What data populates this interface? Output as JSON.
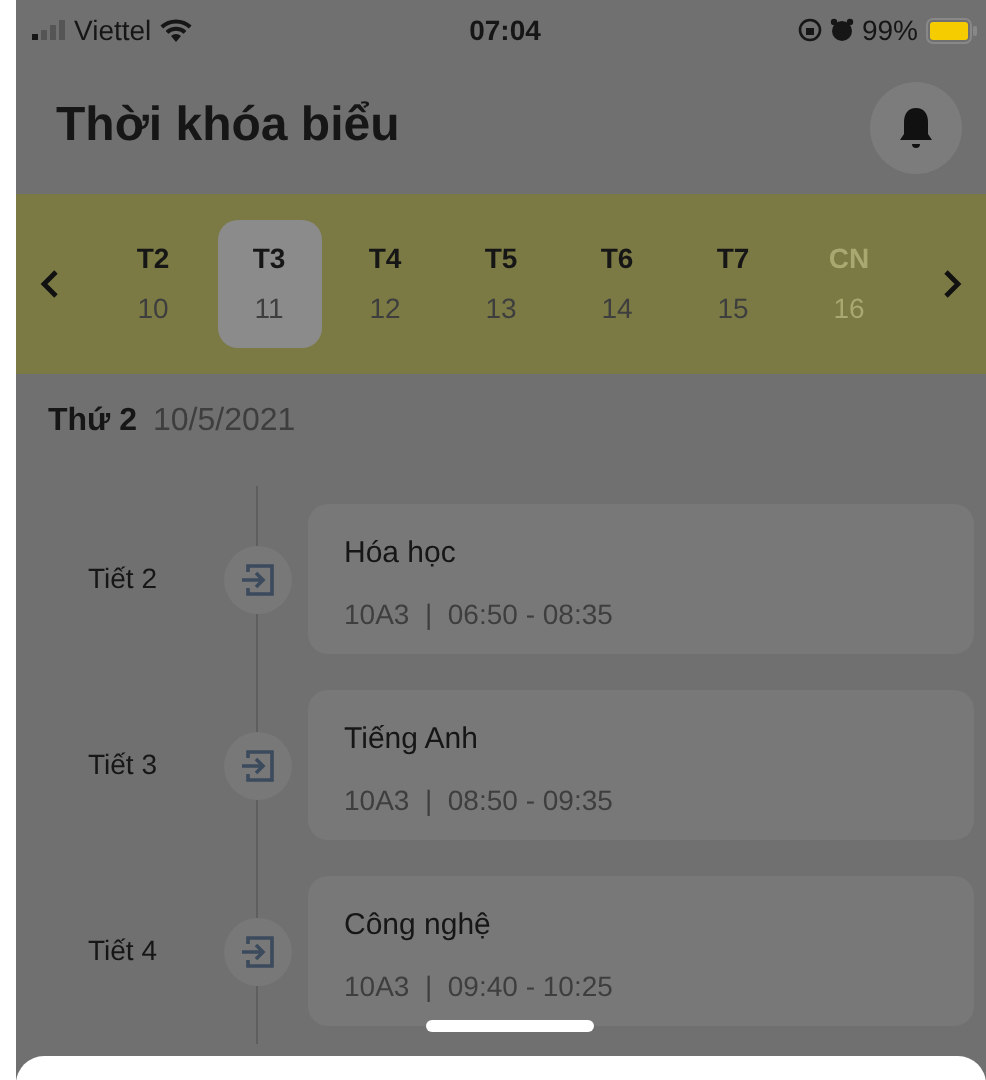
{
  "status_bar": {
    "carrier": "Viettel",
    "time": "07:04",
    "battery": "99%"
  },
  "title": "Thời khóa biểu",
  "week": {
    "days": [
      {
        "label": "T2",
        "date": "10",
        "selected": false,
        "disabled": false
      },
      {
        "label": "T3",
        "date": "11",
        "selected": true,
        "disabled": false
      },
      {
        "label": "T4",
        "date": "12",
        "selected": false,
        "disabled": false
      },
      {
        "label": "T5",
        "date": "13",
        "selected": false,
        "disabled": false
      },
      {
        "label": "T6",
        "date": "14",
        "selected": false,
        "disabled": false
      },
      {
        "label": "T7",
        "date": "15",
        "selected": false,
        "disabled": false
      },
      {
        "label": "CN",
        "date": "16",
        "selected": false,
        "disabled": true
      }
    ]
  },
  "date_heading": {
    "weekday": "Thứ 2",
    "date": "10/5/2021"
  },
  "lessons": [
    {
      "period": "Tiết 2",
      "subject": "Hóa học",
      "detail": "10A3  |  06:50 - 08:35"
    },
    {
      "period": "Tiết 3",
      "subject": "Tiếng Anh",
      "detail": "10A3  |  08:50 - 09:35"
    },
    {
      "period": "Tiết 4",
      "subject": "Công nghệ",
      "detail": "10A3  |  09:40 - 10:25"
    }
  ]
}
